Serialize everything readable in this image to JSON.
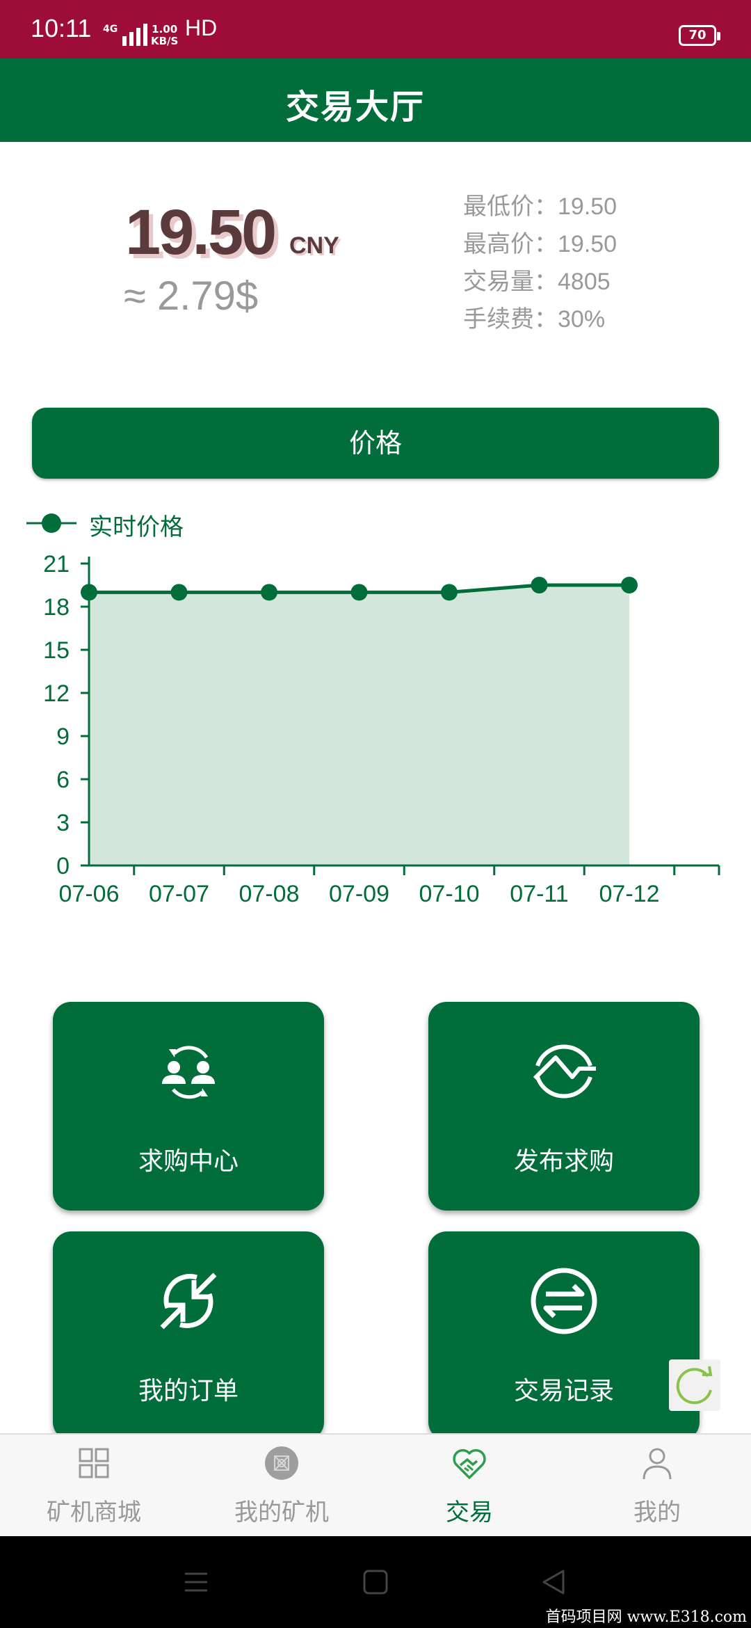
{
  "status_bar": {
    "time": "10:11",
    "signal": "4G",
    "rate_top": "1.00",
    "rate_bottom": "KB/S",
    "hd": "HD",
    "battery": "70"
  },
  "header": {
    "title": "交易大厅"
  },
  "price": {
    "value": "19.50",
    "currency": "CNY",
    "usd": "≈ 2.79$"
  },
  "stats": [
    {
      "label": "最低价：",
      "value": "19.50"
    },
    {
      "label": "最高价：",
      "value": "19.50"
    },
    {
      "label": "交易量：",
      "value": "4805"
    },
    {
      "label": "手续费：",
      "value": "30%"
    }
  ],
  "price_button": {
    "label": "价格"
  },
  "chart_data": {
    "type": "area",
    "categories": [
      "07-06",
      "07-07",
      "07-08",
      "07-09",
      "07-10",
      "07-11",
      "07-12"
    ],
    "series": [
      {
        "name": "实时价格",
        "values": [
          19,
          19,
          19,
          19,
          19,
          19.5,
          19.5
        ]
      }
    ],
    "yticks": [
      0,
      3,
      6,
      9,
      12,
      15,
      18,
      21
    ],
    "ylim": [
      0,
      21
    ],
    "grid": false,
    "legend": "top-left",
    "color": "#006d3b",
    "fill_color": "#d2e6dc"
  },
  "tiles": [
    {
      "label": "求购中心",
      "icon": "people-exchange-icon"
    },
    {
      "label": "发布求购",
      "icon": "wave-circle-icon"
    },
    {
      "label": "我的订单",
      "icon": "arrows-in-circle-icon"
    },
    {
      "label": "交易记录",
      "icon": "swap-arrows-icon"
    }
  ],
  "tabs": [
    {
      "label": "矿机商城",
      "icon": "grid-icon"
    },
    {
      "label": "我的矿机",
      "icon": "miner-icon"
    },
    {
      "label": "交易",
      "icon": "heart-handshake-icon",
      "active": true
    },
    {
      "label": "我的",
      "icon": "user-icon"
    }
  ],
  "watermark": "首码项目网 www.E318.com",
  "colors": {
    "status": "#9e0c38",
    "primary": "#006d3b",
    "muted": "#999999"
  }
}
